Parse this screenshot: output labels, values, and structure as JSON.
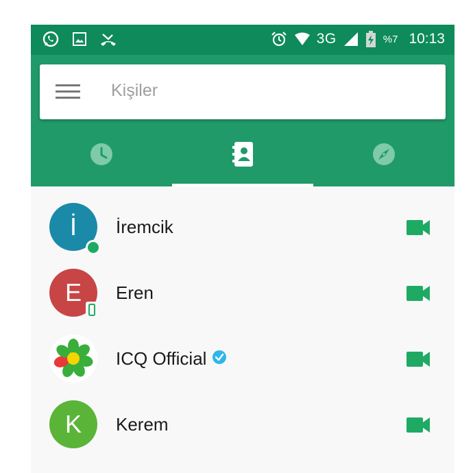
{
  "colors": {
    "status_bar": "#0e8a5b",
    "app_bar": "#209a69",
    "accent_green": "#1faa64"
  },
  "status_bar": {
    "left_icons": [
      "whatsapp-icon",
      "image-icon",
      "missed-call-icon"
    ],
    "right_icons": [
      "alarm-icon",
      "wifi-icon",
      "signal-icon",
      "battery-charging-icon"
    ],
    "network": "3G",
    "battery": "%7",
    "time": "10:13"
  },
  "search": {
    "placeholder": "Kişiler"
  },
  "tabs": [
    {
      "icon": "clock-icon",
      "selected": false
    },
    {
      "icon": "contacts-icon",
      "selected": true
    },
    {
      "icon": "compass-icon",
      "selected": false
    }
  ],
  "contacts": [
    {
      "name": "İremcik",
      "initial": "İ",
      "avatar_color": "#1a8aa8",
      "status": "online",
      "verified": false
    },
    {
      "name": "Eren",
      "initial": "E",
      "avatar_color": "#c84545",
      "status": "mobile",
      "verified": false
    },
    {
      "name": "ICQ Official",
      "initial": "",
      "avatar_color": "#ffffff",
      "status": "none",
      "verified": true
    },
    {
      "name": "Kerem",
      "initial": "K",
      "avatar_color": "#5ab438",
      "status": "none",
      "verified": false
    }
  ]
}
